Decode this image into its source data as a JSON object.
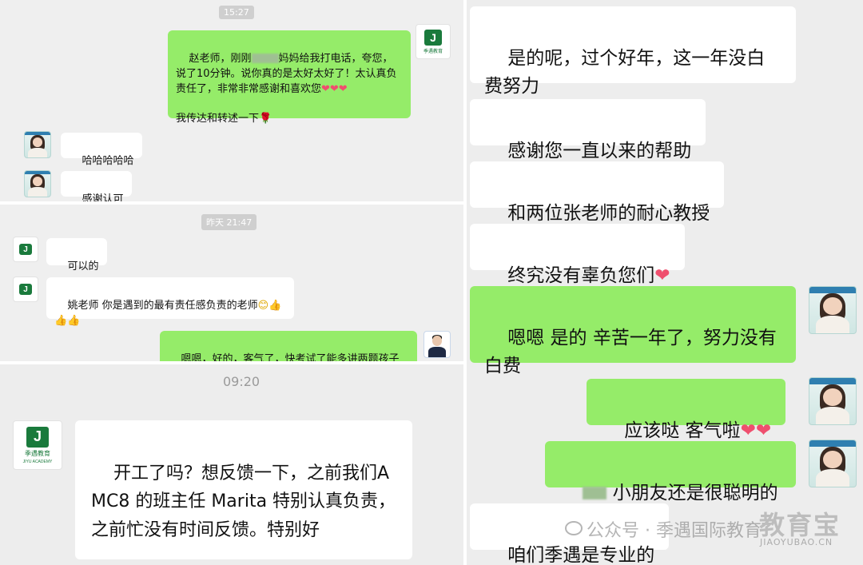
{
  "panel1": {
    "timestamp": "15:27",
    "msg_praise": "赵老师，刚刚",
    "msg_praise_tail": "妈妈给我打电话，夸您，说了10分钟。说你真的是太好太好了！太认真负责任了，非常非常感谢和喜欢您",
    "hearts": "❤❤❤",
    "msg_relay": "我传达和转述一下",
    "rose": "🌹",
    "msg_haha": "哈哈哈哈哈",
    "msg_thanks": "感谢认可"
  },
  "panel2": {
    "timestamp": "昨天 21:47",
    "msg_ok": "可以的",
    "msg_yao": "姚老师 你是遇到的最有责任感负责的老师",
    "yao_emoji": "😊👍👍👍",
    "msg_reply": "嗯嗯，好的，客气了，快考试了能多讲两题孩子也能少点困扰"
  },
  "panel3": {
    "timestamp": "09:20",
    "msg_feedback": "开工了吗？想反馈一下，之前我们AMC8 的班主任 Marita 特别认真负责，之前忙没有时间反馈。特别好"
  },
  "panel4": {
    "msg1": "是的呢，过个好年，这一年没白费努力",
    "msg2": "感谢您一直以来的帮助",
    "msg3": "和两位张老师的耐心教授",
    "msg4": "终究没有辜负您们",
    "msg4_heart": "❤",
    "msg5": "嗯嗯 是的 辛苦一年了，努力没有白费",
    "msg6": "应该哒 客气啦",
    "msg6_hearts": "❤❤",
    "msg7": "小朋友还是很聪明的",
    "msg8": "咱们季遇是专业的"
  },
  "logo": {
    "mark": "J",
    "name_cn": "季遇教育",
    "name_en": "JIYU ACADEMY"
  },
  "watermark": {
    "account": "公众号 · 季遇国际教育",
    "site_cn": "教育宝",
    "site_url": "JIAOYUBAO.CN"
  },
  "colors": {
    "green_bubble": "#95ec69",
    "white_bubble": "#ffffff",
    "background": "#ededed",
    "brand_green": "#1a7a3c"
  }
}
